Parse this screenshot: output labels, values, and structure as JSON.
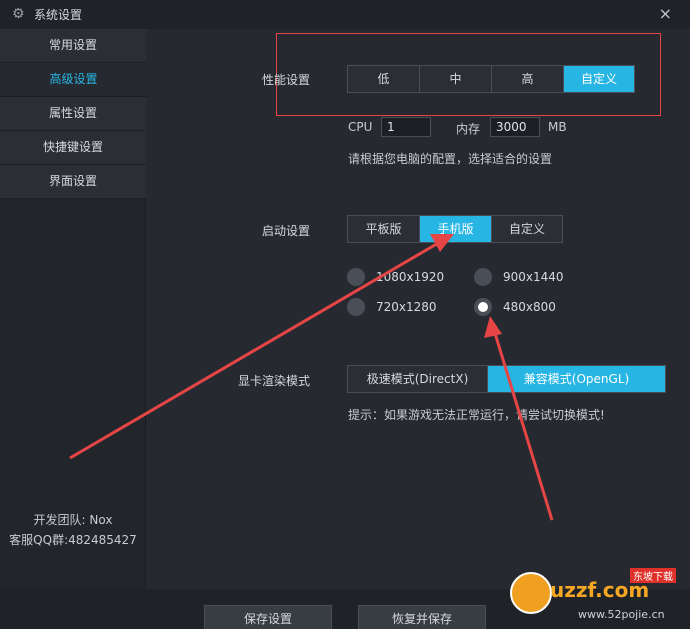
{
  "window": {
    "title": "系统设置",
    "close_glyph": "×"
  },
  "sidebar": {
    "items": [
      {
        "label": "常用设置",
        "active": false
      },
      {
        "label": "高级设置",
        "active": true
      },
      {
        "label": "属性设置",
        "active": false
      },
      {
        "label": "快捷键设置",
        "active": false
      },
      {
        "label": "界面设置",
        "active": false
      }
    ],
    "footer_team": "开发团队: Nox",
    "footer_qq": "客服QQ群:482485427"
  },
  "performance": {
    "label": "性能设置",
    "options": [
      "低",
      "中",
      "高",
      "自定义"
    ],
    "selected": "自定义",
    "cpu_label": "CPU",
    "cpu_value": "1",
    "mem_label": "内存",
    "mem_value": "3000",
    "mem_unit": "MB",
    "hint": "请根据您电脑的配置，选择适合的设置"
  },
  "startup": {
    "label": "启动设置",
    "options": [
      "平板版",
      "手机版",
      "自定义"
    ],
    "selected": "手机版",
    "resolutions": [
      "1080x1920",
      "900x1440",
      "720x1280",
      "480x800"
    ],
    "selected_resolution": "480x800"
  },
  "render": {
    "label": "显卡渲染模式",
    "options": [
      "极速模式(DirectX)",
      "兼容模式(OpenGL)"
    ],
    "selected": "兼容模式(OpenGL)",
    "hint": "提示：如果游戏无法正常运行，请尝试切换模式!"
  },
  "footer": {
    "save_label": "保存设置",
    "restore_label": "恢复并保存"
  },
  "watermark": {
    "brand": "uzzf.com",
    "tag": "东坡下载",
    "url": "www.52pojie.cn"
  },
  "colors": {
    "accent": "#27b5e3",
    "annotation": "#e64545"
  }
}
